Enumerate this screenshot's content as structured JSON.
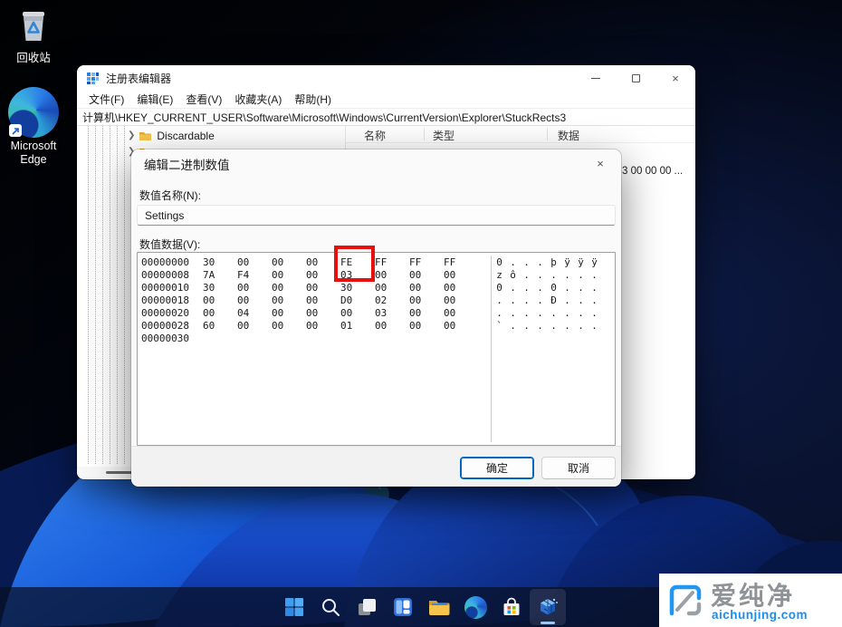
{
  "desktop": {
    "recycle_bin_label": "回收站",
    "edge_label": "Microsoft Edge"
  },
  "regedit_window": {
    "title": "注册表编辑器",
    "menu_items": [
      "文件(F)",
      "编辑(E)",
      "查看(V)",
      "收藏夹(A)",
      "帮助(H)"
    ],
    "address": "计算机\\HKEY_CURRENT_USER\\Software\\Microsoft\\Windows\\CurrentVersion\\Explorer\\StuckRects3",
    "tree": {
      "visible_item": "Discardable"
    },
    "list_columns": [
      "名称",
      "类型",
      "数据"
    ],
    "partial_data_value": "3 00 00 00 ..."
  },
  "dialog": {
    "title": "编辑二进制数值",
    "value_name_label": "数值名称(N):",
    "value_name": "Settings",
    "value_data_label": "数值数据(V):",
    "hex_rows": [
      {
        "offset": "00000000",
        "bytes": [
          "30",
          "00",
          "00",
          "00",
          "FE",
          "FF",
          "FF",
          "FF"
        ],
        "ascii": [
          "0",
          ".",
          ".",
          ".",
          "þ",
          "ÿ",
          "ÿ",
          "ÿ"
        ]
      },
      {
        "offset": "00000008",
        "bytes": [
          "7A",
          "F4",
          "00",
          "00",
          "03",
          "00",
          "00",
          "00"
        ],
        "ascii": [
          "z",
          "ô",
          ".",
          ".",
          ".",
          ".",
          ".",
          "."
        ]
      },
      {
        "offset": "00000010",
        "bytes": [
          "30",
          "00",
          "00",
          "00",
          "30",
          "00",
          "00",
          "00"
        ],
        "ascii": [
          "0",
          ".",
          ".",
          ".",
          "0",
          ".",
          ".",
          "."
        ]
      },
      {
        "offset": "00000018",
        "bytes": [
          "00",
          "00",
          "00",
          "00",
          "D0",
          "02",
          "00",
          "00"
        ],
        "ascii": [
          ".",
          ".",
          ".",
          ".",
          "Ð",
          ".",
          ".",
          "."
        ]
      },
      {
        "offset": "00000020",
        "bytes": [
          "00",
          "04",
          "00",
          "00",
          "00",
          "03",
          "00",
          "00"
        ],
        "ascii": [
          ".",
          ".",
          ".",
          ".",
          ".",
          ".",
          ".",
          "."
        ]
      },
      {
        "offset": "00000028",
        "bytes": [
          "60",
          "00",
          "00",
          "00",
          "01",
          "00",
          "00",
          "00"
        ],
        "ascii": [
          "`",
          ".",
          ".",
          ".",
          ".",
          ".",
          ".",
          "."
        ]
      },
      {
        "offset": "00000030",
        "bytes": [],
        "ascii": []
      }
    ],
    "highlight_color": "#e8100c",
    "ok_label": "确定",
    "cancel_label": "取消"
  },
  "taskbar": {
    "icons": [
      {
        "name": "start"
      },
      {
        "name": "search"
      },
      {
        "name": "task-view"
      },
      {
        "name": "widgets"
      },
      {
        "name": "file-explorer"
      },
      {
        "name": "edge"
      },
      {
        "name": "microsoft-store"
      },
      {
        "name": "registry-editor",
        "active": true
      }
    ]
  },
  "watermark": {
    "brand": "爱纯净",
    "domain": "aichunjing.com"
  },
  "colors": {
    "accent_blue": "#0067c0",
    "highlight_red": "#e8100c",
    "watermark_blue": "#1f8ce8"
  }
}
